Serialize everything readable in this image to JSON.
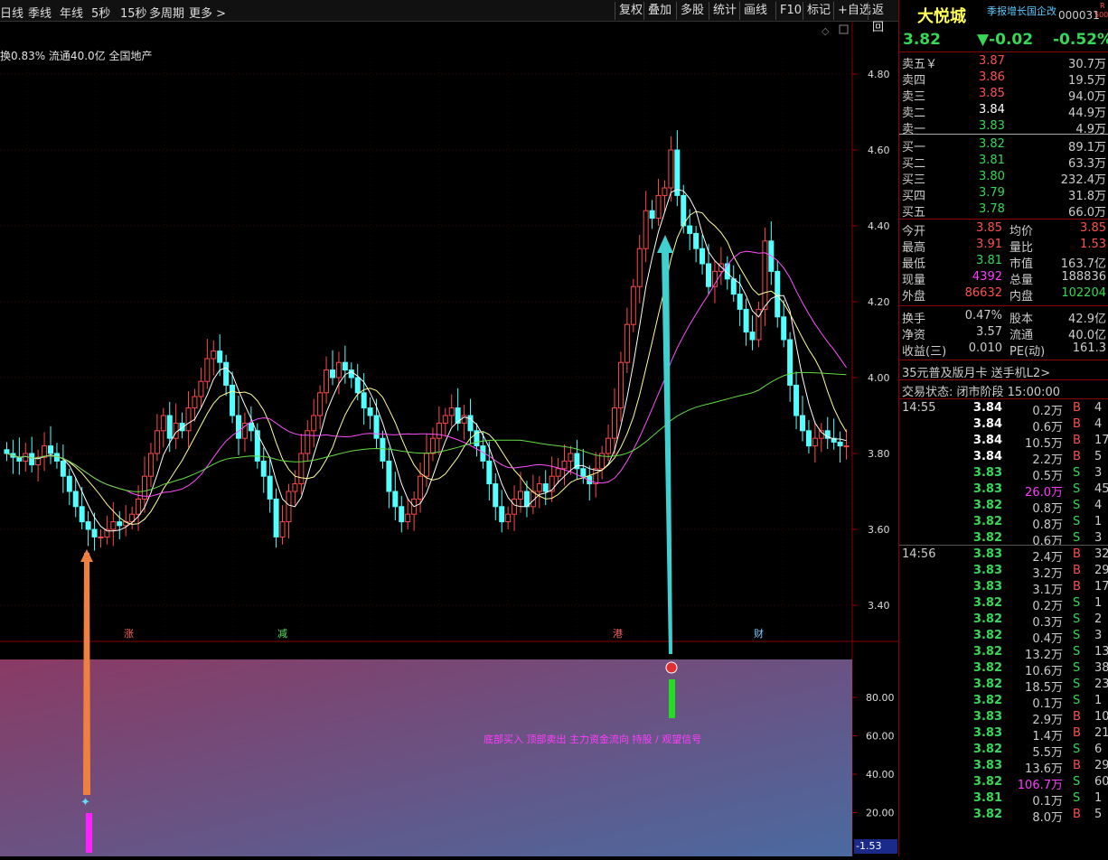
{
  "toolbar": {
    "left": [
      "日线",
      "季线",
      "年线",
      "5秒",
      "15秒",
      "多周期",
      "更多 >"
    ],
    "right": [
      "复权",
      "叠加",
      "多股",
      "统计",
      "画线",
      "F10",
      "标记",
      "+自选",
      "返回"
    ]
  },
  "stock": {
    "name": "大悦城",
    "code": "000031",
    "tag": "季报增长国企改",
    "badge_top": "R",
    "badge_bot": "500",
    "price": "3.82",
    "change": "▼-0.02",
    "pct": "-0.52%"
  },
  "chart_info": "换0.83% 流通40.0亿 全国地产",
  "price_axis": [
    "4.80",
    "4.60",
    "4.40",
    "4.20",
    "4.00",
    "3.80",
    "3.60",
    "3.40"
  ],
  "ind_axis": [
    "80.00",
    "60.00",
    "40.00",
    "20.00"
  ],
  "ind_value": "-1.53",
  "events": [
    {
      "t": "涨",
      "c": "#ff6060"
    },
    {
      "t": "减",
      "c": "#5ce35c"
    },
    {
      "t": "港",
      "c": "#ff6060"
    },
    {
      "t": "财",
      "c": "#7fc8ff"
    }
  ],
  "ind_text": "底部买入 顶部卖出 主力资金流向 持股 / 观望信号",
  "order_book": {
    "asks": [
      {
        "label": "卖五￥",
        "price": "3.87",
        "vol": "30.7万",
        "pc": "red"
      },
      {
        "label": "卖四",
        "price": "3.86",
        "vol": "19.5万",
        "pc": "red"
      },
      {
        "label": "卖三",
        "price": "3.85",
        "vol": "94.0万",
        "pc": "red"
      },
      {
        "label": "卖二",
        "price": "3.84",
        "vol": "44.9万",
        "pc": "wht"
      },
      {
        "label": "卖一",
        "price": "3.83",
        "vol": "4.9万",
        "pc": "grn"
      }
    ],
    "bids": [
      {
        "label": "买一",
        "price": "3.82",
        "vol": "89.1万",
        "pc": "grn"
      },
      {
        "label": "买二",
        "price": "3.81",
        "vol": "63.3万",
        "pc": "grn"
      },
      {
        "label": "买三",
        "price": "3.80",
        "vol": "232.4万",
        "pc": "grn"
      },
      {
        "label": "买四",
        "price": "3.79",
        "vol": "31.8万",
        "pc": "grn"
      },
      {
        "label": "买五",
        "price": "3.78",
        "vol": "66.0万",
        "pc": "grn"
      }
    ]
  },
  "stats": [
    {
      "l1": "今开",
      "v1": "3.85",
      "c1": "red",
      "l2": "均价",
      "v2": "3.85",
      "c2": "red"
    },
    {
      "l1": "最高",
      "v1": "3.91",
      "c1": "red",
      "l2": "量比",
      "v2": "1.53",
      "c2": "red"
    },
    {
      "l1": "最低",
      "v1": "3.81",
      "c1": "grn",
      "l2": "市值",
      "v2": "163.7亿",
      "c2": "gry"
    },
    {
      "l1": "现量",
      "v1": "4392",
      "c1": "mag",
      "l2": "总量",
      "v2": "188836",
      "c2": "gry"
    },
    {
      "l1": "外盘",
      "v1": "86632",
      "c1": "red",
      "l2": "内盘",
      "v2": "102204",
      "c2": "grn"
    }
  ],
  "stats2": [
    {
      "l1": "换手",
      "v1": "0.47%",
      "l2": "股本",
      "v2": "42.9亿"
    },
    {
      "l1": "净资",
      "v1": "3.57",
      "l2": "流通",
      "v2": "40.0亿"
    },
    {
      "l1": "收益(三)",
      "v1": "0.010",
      "l2": "PE(动)",
      "v2": "161.3"
    }
  ],
  "promo": "35元普及版月卡 送手机L2>",
  "trade_status": "交易状态: 闭市阶段 15:00:00",
  "ticks": [
    {
      "time": "14:55",
      "p": "3.84",
      "pc": "wht",
      "v": "0.2万",
      "vc": "gry",
      "s": "B",
      "n": "4"
    },
    {
      "time": "",
      "p": "3.84",
      "pc": "wht",
      "v": "0.6万",
      "vc": "gry",
      "s": "B",
      "n": "4"
    },
    {
      "time": "",
      "p": "3.84",
      "pc": "wht",
      "v": "10.5万",
      "vc": "gry",
      "s": "B",
      "n": "17"
    },
    {
      "time": "",
      "p": "3.84",
      "pc": "wht",
      "v": "2.2万",
      "vc": "gry",
      "s": "B",
      "n": "5"
    },
    {
      "time": "",
      "p": "3.83",
      "pc": "grn",
      "v": "0.5万",
      "vc": "gry",
      "s": "S",
      "n": "3"
    },
    {
      "time": "",
      "p": "3.83",
      "pc": "grn",
      "v": "26.0万",
      "vc": "mag",
      "s": "S",
      "n": "45"
    },
    {
      "time": "",
      "p": "3.82",
      "pc": "grn",
      "v": "0.8万",
      "vc": "gry",
      "s": "S",
      "n": "4"
    },
    {
      "time": "",
      "p": "3.82",
      "pc": "grn",
      "v": "0.8万",
      "vc": "gry",
      "s": "S",
      "n": "1"
    },
    {
      "time": "",
      "p": "3.82",
      "pc": "grn",
      "v": "0.6万",
      "vc": "gry",
      "s": "S",
      "n": "3"
    },
    {
      "time": "14:56",
      "p": "3.83",
      "pc": "grn",
      "v": "2.4万",
      "vc": "gry",
      "s": "B",
      "n": "32"
    },
    {
      "time": "",
      "p": "3.83",
      "pc": "grn",
      "v": "3.2万",
      "vc": "gry",
      "s": "B",
      "n": "29"
    },
    {
      "time": "",
      "p": "3.83",
      "pc": "grn",
      "v": "3.1万",
      "vc": "gry",
      "s": "B",
      "n": "17"
    },
    {
      "time": "",
      "p": "3.82",
      "pc": "grn",
      "v": "0.2万",
      "vc": "gry",
      "s": "S",
      "n": "1"
    },
    {
      "time": "",
      "p": "3.82",
      "pc": "grn",
      "v": "0.3万",
      "vc": "gry",
      "s": "S",
      "n": "2"
    },
    {
      "time": "",
      "p": "3.82",
      "pc": "grn",
      "v": "0.4万",
      "vc": "gry",
      "s": "S",
      "n": "3"
    },
    {
      "time": "",
      "p": "3.82",
      "pc": "grn",
      "v": "13.2万",
      "vc": "gry",
      "s": "S",
      "n": "13"
    },
    {
      "time": "",
      "p": "3.82",
      "pc": "grn",
      "v": "10.6万",
      "vc": "gry",
      "s": "S",
      "n": "38"
    },
    {
      "time": "",
      "p": "3.82",
      "pc": "grn",
      "v": "18.5万",
      "vc": "gry",
      "s": "S",
      "n": "23"
    },
    {
      "time": "",
      "p": "3.82",
      "pc": "grn",
      "v": "0.1万",
      "vc": "gry",
      "s": "S",
      "n": "1"
    },
    {
      "time": "",
      "p": "3.83",
      "pc": "grn",
      "v": "2.9万",
      "vc": "gry",
      "s": "B",
      "n": "10"
    },
    {
      "time": "",
      "p": "3.83",
      "pc": "grn",
      "v": "1.4万",
      "vc": "gry",
      "s": "B",
      "n": "21"
    },
    {
      "time": "",
      "p": "3.82",
      "pc": "grn",
      "v": "5.5万",
      "vc": "gry",
      "s": "S",
      "n": "6"
    },
    {
      "time": "",
      "p": "3.83",
      "pc": "grn",
      "v": "13.6万",
      "vc": "gry",
      "s": "B",
      "n": "29"
    },
    {
      "time": "",
      "p": "3.82",
      "pc": "grn",
      "v": "106.7万",
      "vc": "mag",
      "s": "S",
      "n": "60"
    },
    {
      "time": "",
      "p": "3.81",
      "pc": "grn",
      "v": "0.1万",
      "vc": "gry",
      "s": "S",
      "n": "1"
    },
    {
      "time": "",
      "p": "3.82",
      "pc": "grn",
      "v": "8.0万",
      "vc": "gry",
      "s": "B",
      "n": "5"
    }
  ]
}
